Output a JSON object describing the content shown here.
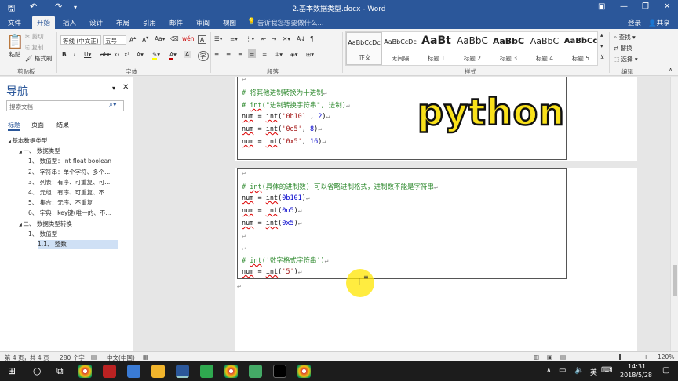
{
  "title_bar": {
    "document_title": "2.基本数据类型.docx - Word",
    "minimize": "—",
    "restore": "❐",
    "close": "✕"
  },
  "tabs": [
    "文件",
    "开始",
    "插入",
    "设计",
    "布局",
    "引用",
    "邮件",
    "审阅",
    "视图"
  ],
  "active_tab": "开始",
  "tell_me": "告诉我您想要做什么...",
  "account": {
    "login": "登录",
    "share": "共享"
  },
  "ribbon": {
    "clipboard": {
      "label": "剪贴板",
      "paste": "粘贴",
      "cut": "剪切",
      "copy": "复制",
      "format_painter": "格式刷"
    },
    "font": {
      "label": "字体",
      "font_name": "等线 (中文正)",
      "font_size": "五号",
      "font_color": "#c00000",
      "highlight_color": "#ffff00"
    },
    "paragraph": {
      "label": "段落"
    },
    "styles": {
      "label": "样式",
      "items": [
        {
          "sample": "AaBbCcDc",
          "name": "正文"
        },
        {
          "sample": "AaBbCcDc",
          "name": "无间隔"
        },
        {
          "sample": "AaBt",
          "name": "标题 1"
        },
        {
          "sample": "AaBbC",
          "name": "标题 2"
        },
        {
          "sample": "AaBbC",
          "name": "标题 3"
        },
        {
          "sample": "AaBbC",
          "name": "标题 4"
        },
        {
          "sample": "AaBbCc",
          "name": "标题 5"
        }
      ]
    },
    "editing": {
      "label": "编辑",
      "find": "查找",
      "replace": "替换",
      "select": "选择"
    }
  },
  "nav": {
    "title": "导航",
    "search_placeholder": "搜索文档",
    "tabs": [
      "标题",
      "页面",
      "结果"
    ],
    "tree": [
      {
        "text": "基本数据类型",
        "level": 0
      },
      {
        "text": "一、 数据类型",
        "level": 1
      },
      {
        "text": "1、 数值型：int float boolean",
        "level": 2
      },
      {
        "text": "2、 字符串：单个字符、多个...",
        "level": 2
      },
      {
        "text": "3、 列表：有序、可重复、可...",
        "level": 2
      },
      {
        "text": "4、 元组：有序、可重复、不...",
        "level": 2
      },
      {
        "text": "5、 集合：无序、不重复",
        "level": 2
      },
      {
        "text": "6、 字典：key键(唯一的、不...",
        "level": 2
      },
      {
        "text": "二、 数据类型转换",
        "level": 1
      },
      {
        "text": "1、 数值型",
        "level": 2
      },
      {
        "text": "1.1、 整数",
        "level": 3
      }
    ]
  },
  "overlay_text": "python",
  "doc": {
    "block1": [
      "# 将其他进制转换为十进制",
      "# int(\"进制转换字符串\", 进制)",
      "num = int('0b101', 2)",
      "num = int('0o5', 8)",
      "num = int('0x5', 16)"
    ],
    "block2": [
      "# int(具体的进制数) 可以省略进制格式，进制数不能是字符串",
      "num = int(0b101)",
      "num = int(0o5)",
      "num = int(0x5)",
      "# int('数字格式字符串')",
      "num = int('5')"
    ],
    "para_mark": "↵"
  },
  "status": {
    "page": "第 4 页，共 4 页",
    "words": "280 个字",
    "lang": "中文(中国)",
    "zoom": "120%"
  },
  "taskbar": {
    "time": "14:31",
    "date": "2018/5/28",
    "ime": "英"
  }
}
